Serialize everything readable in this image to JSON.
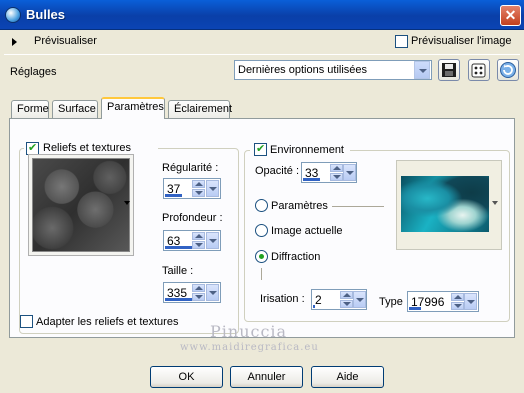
{
  "window": {
    "title": "Bulles",
    "close_glyph": "✕"
  },
  "preview": {
    "label": "Prévisualiser",
    "checkbox_label": "Prévisualiser l'image",
    "checked": false
  },
  "settings": {
    "label": "Réglages",
    "preset_value": "Dernières options utilisées"
  },
  "icons": [
    "save-icon",
    "dice-icon",
    "reset-icon"
  ],
  "tabs": [
    {
      "label": "Forme",
      "active": false
    },
    {
      "label": "Surface",
      "active": false
    },
    {
      "label": "Paramètres",
      "active": true
    },
    {
      "label": "Éclairement",
      "active": false
    }
  ],
  "reliefs": {
    "checkbox_label": "Reliefs et textures",
    "checked": true,
    "regularite": {
      "label": "Régularité :",
      "value": "37",
      "level": 0.37
    },
    "profondeur": {
      "label": "Profondeur :",
      "value": "63",
      "level": 0.63
    },
    "taille": {
      "label": "Taille :",
      "value": "335",
      "level": 0.9
    },
    "adapt_label": "Adapter les reliefs et textures",
    "adapt_checked": false
  },
  "environment": {
    "checkbox_label": "Environnement",
    "checked": true,
    "opacity": {
      "label": "Opacité :",
      "value": "33",
      "level": 0.33
    },
    "options": [
      {
        "label": "Paramètres",
        "selected": false
      },
      {
        "label": "Image actuelle",
        "selected": false
      },
      {
        "label": "Diffraction",
        "selected": true
      }
    ],
    "irisation": {
      "label": "Irisation :",
      "value": "2",
      "level": 0.02
    },
    "type": {
      "label": "Type",
      "value": "17996",
      "level": 0.2
    }
  },
  "watermark": {
    "name": "Pinuccia",
    "url": "www.maidiregrafica.eu"
  },
  "buttons": {
    "ok": "OK",
    "cancel": "Annuler",
    "help": "Aide"
  },
  "colors": {
    "titlebar": "#0a4fc8",
    "dialog_bg": "#ece9d8",
    "accent_bar": "#3162c4",
    "check_green": "#21a121"
  }
}
